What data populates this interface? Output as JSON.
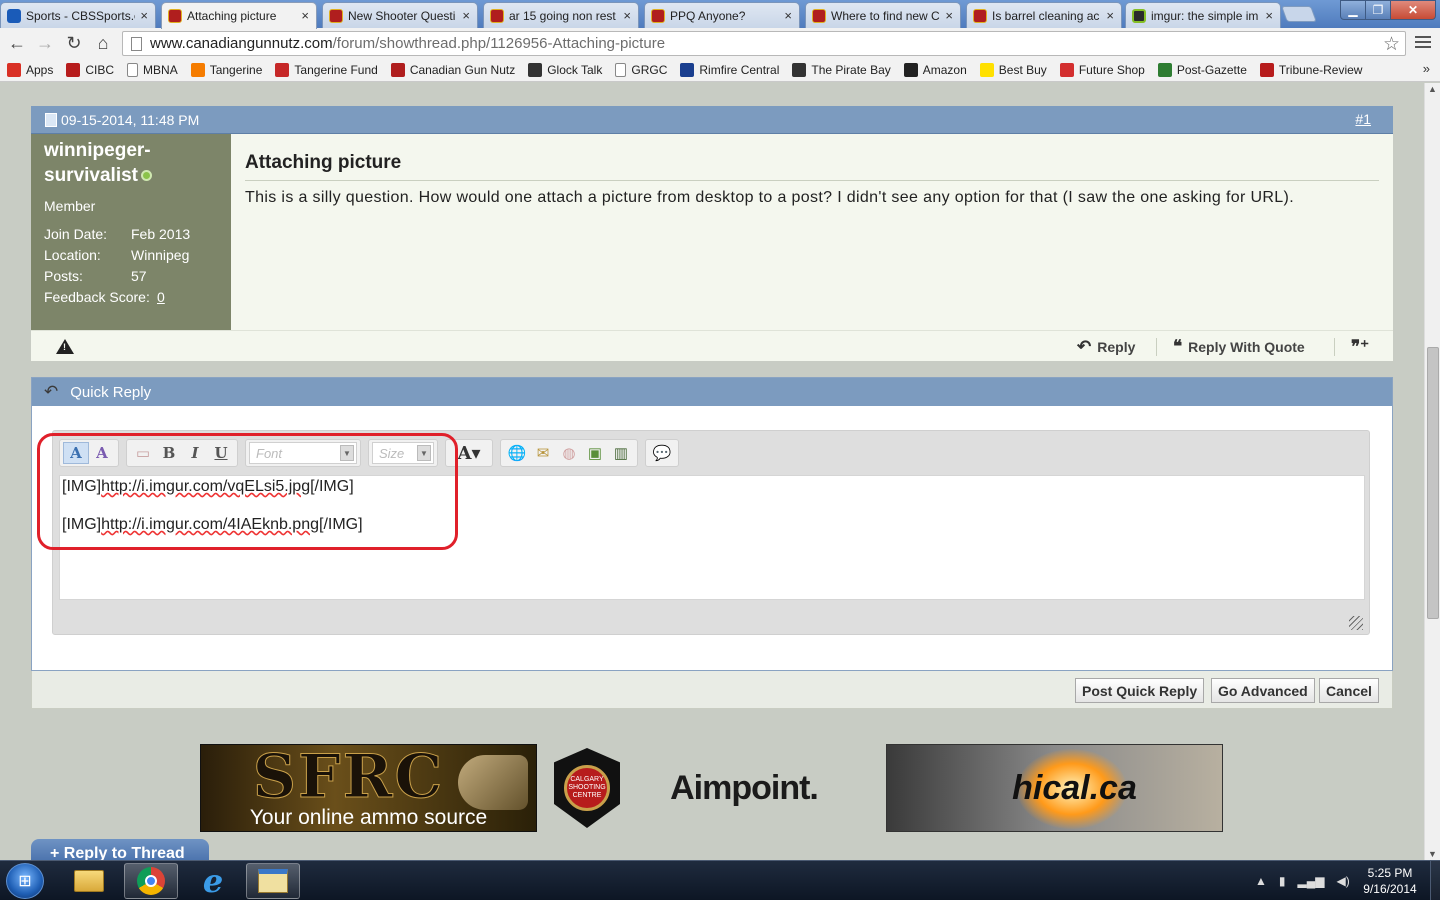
{
  "browser": {
    "tabs": [
      {
        "title": "Sports - CBSSports.c",
        "icon": "cbs-icon",
        "active": false
      },
      {
        "title": "Attaching picture",
        "icon": "cgn-icon",
        "active": true
      },
      {
        "title": "New Shooter Questi",
        "icon": "cgn-icon",
        "active": false
      },
      {
        "title": "ar 15 going non rest",
        "icon": "cgn-icon",
        "active": false
      },
      {
        "title": "PPQ Anyone?",
        "icon": "cgn-icon",
        "active": false
      },
      {
        "title": "Where to find new C",
        "icon": "cgn-icon",
        "active": false
      },
      {
        "title": "Is barrel cleaning ac",
        "icon": "cgn-icon",
        "active": false
      },
      {
        "title": "imgur: the simple im",
        "icon": "imgur-icon",
        "active": false
      }
    ],
    "url_host": "www.canadiangunnutz.com",
    "url_path": "/forum/showthread.php/1126956-Attaching-picture",
    "bookmarks": [
      {
        "label": "Apps",
        "icon": "apps-icon",
        "color": "#d93025"
      },
      {
        "label": "CIBC",
        "icon": "cibc-icon",
        "color": "#b71c1c"
      },
      {
        "label": "MBNA",
        "icon": "page-icon",
        "color": "#ffffff"
      },
      {
        "label": "Tangerine",
        "icon": "tangerine-icon",
        "color": "#f57c00"
      },
      {
        "label": "Tangerine Fund",
        "icon": "tangerine-fund-icon",
        "color": "#c62828"
      },
      {
        "label": "Canadian Gun Nutz",
        "icon": "cgn-icon",
        "color": "#b01e1e"
      },
      {
        "label": "Glock Talk",
        "icon": "pistol-icon",
        "color": "#333333"
      },
      {
        "label": "GRGC",
        "icon": "page-icon",
        "color": "#ffffff"
      },
      {
        "label": "Rimfire Central",
        "icon": "flag-icon",
        "color": "#1a3f8f"
      },
      {
        "label": "The Pirate Bay",
        "icon": "ship-icon",
        "color": "#333333"
      },
      {
        "label": "Amazon",
        "icon": "amazon-icon",
        "color": "#222222"
      },
      {
        "label": "Best Buy",
        "icon": "bestbuy-icon",
        "color": "#ffe000"
      },
      {
        "label": "Future Shop",
        "icon": "futureshop-icon",
        "color": "#d32f2f"
      },
      {
        "label": "Post-Gazette",
        "icon": "postgazette-icon",
        "color": "#2e7d32"
      },
      {
        "label": "Tribune-Review",
        "icon": "tribune-icon",
        "color": "#b71c1c"
      }
    ],
    "bookmarks_overflow": "»"
  },
  "post": {
    "date": "09-15-2014, 11:48 PM",
    "number": "#1",
    "user": {
      "name": "winnipeger-survivalist",
      "title": "Member",
      "join_label": "Join Date:",
      "join_value": "Feb 2013",
      "location_label": "Location:",
      "location_value": "Winnipeg",
      "posts_label": "Posts:",
      "posts_value": "57",
      "feedback_label": "Feedback Score:",
      "feedback_value": "0"
    },
    "title": "Attaching picture",
    "body": "This is a silly question. How would one attach a picture from desktop to a post? I didn't see any option for that (I saw the one asking for URL).",
    "reply_label": "Reply",
    "reply_quote_label": "Reply With Quote"
  },
  "quick_reply": {
    "header": "Quick Reply",
    "font_placeholder": "Font",
    "size_placeholder": "Size",
    "lines": [
      {
        "open": "[IMG]",
        "url": "http://i.imgur.com/vqELsi5.jpg",
        "close": "[/IMG]"
      },
      {
        "open": "[IMG]",
        "url": "http://i.imgur.com/4IAEknb.png",
        "close": "[/IMG]"
      }
    ],
    "post_button": "Post Quick Reply",
    "advanced_button": "Go Advanced",
    "cancel_button": "Cancel",
    "highlight_color": "#e0202a"
  },
  "sponsors": {
    "sfrc_big": "SFRC",
    "sfrc_tagline": "Your online ammo source",
    "csc_text": "CALGARY SHOOTING CENTRE",
    "aimpoint": "Aimpoint.",
    "hical": "hical.ca"
  },
  "reply_thread": "+ Reply to Thread",
  "taskbar": {
    "time": "5:25 PM",
    "date": "9/16/2014"
  },
  "colors": {
    "header_blue": "#7c9bbf",
    "user_panel": "#7d8569",
    "page_bg": "#c8ccc4"
  }
}
